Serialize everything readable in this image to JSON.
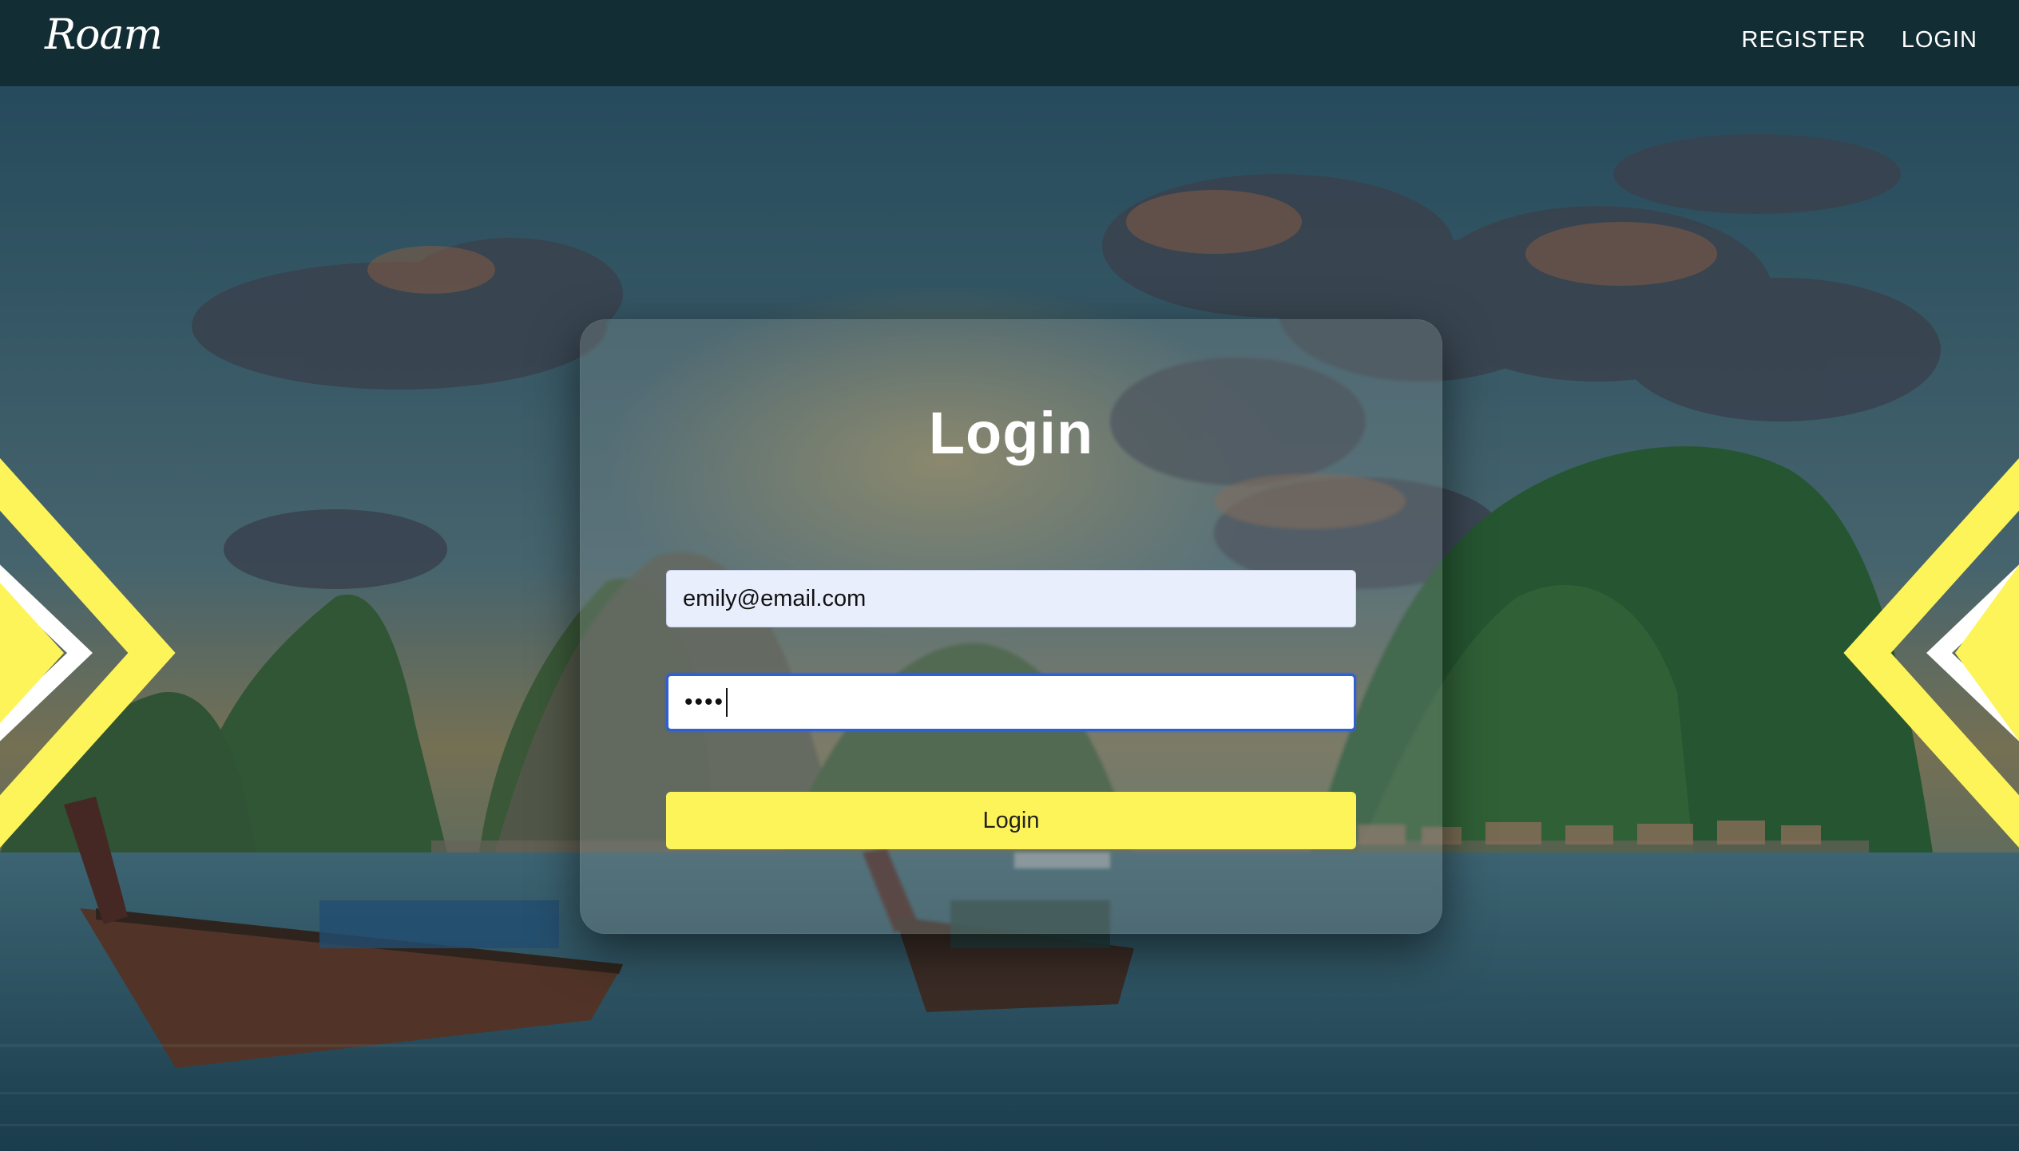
{
  "navbar": {
    "brand": "Roam",
    "links": [
      {
        "label": "REGISTER"
      },
      {
        "label": "LOGIN"
      }
    ]
  },
  "login_form": {
    "title": "Login",
    "email_value": "emily@email.com",
    "password_value": "••••",
    "submit_label": "Login"
  },
  "colors": {
    "navbar_bg": "#132d35",
    "accent_yellow": "#fdf45a",
    "focus_blue": "#2f5fd0",
    "autofill_bg": "#e8eefc"
  }
}
